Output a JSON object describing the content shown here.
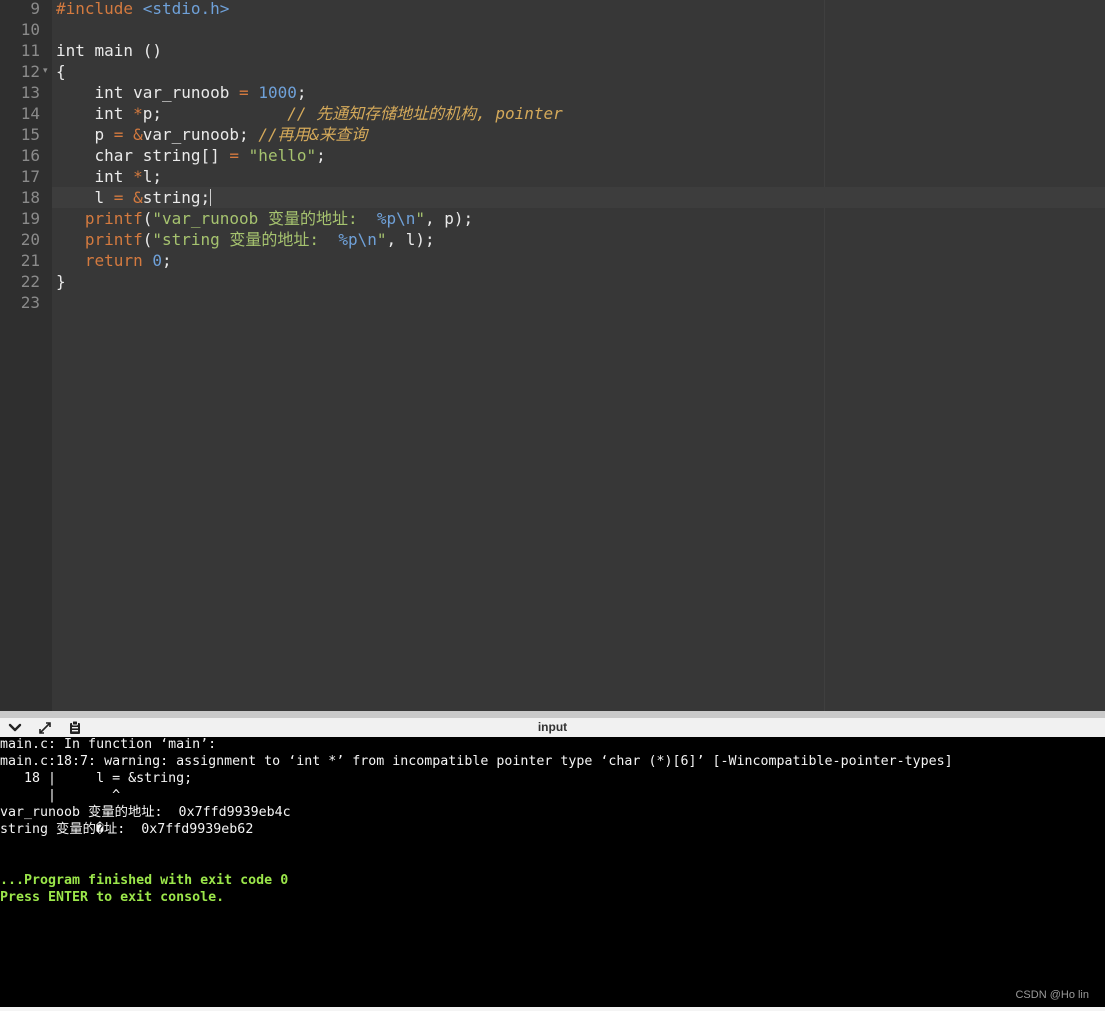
{
  "editor": {
    "line_numbers": [
      "9",
      "10",
      "11",
      "12",
      "13",
      "14",
      "15",
      "16",
      "17",
      "18",
      "19",
      "20",
      "21",
      "22",
      "23"
    ],
    "fold_marker": "▾",
    "code": {
      "l9_directive": "#include",
      "l9_header": " <stdio.h>",
      "l11": "int main ()",
      "l12": "{",
      "l13_a": "    int var_runoob ",
      "l13_op": "=",
      "l13_sp": " ",
      "l13_num": "1000",
      "l13_end": ";",
      "l14_a": "    int ",
      "l14_star": "*",
      "l14_b": "p;",
      "l14_pad": "             ",
      "l14_comment": "// 先通知存储地址的机构, pointer",
      "l15_a": "    p ",
      "l15_op": "=",
      "l15_sp": " ",
      "l15_amp": "&",
      "l15_b": "var_runoob; ",
      "l15_comment": "//再用&来查询",
      "l16_a": "    char string[] ",
      "l16_op": "=",
      "l16_sp": " ",
      "l16_str": "\"hello\"",
      "l16_end": ";",
      "l17_a": "    int ",
      "l17_star": "*",
      "l17_b": "l;",
      "l18_a": "    l ",
      "l18_op": "=",
      "l18_sp": " ",
      "l18_amp": "&",
      "l18_b": "string;",
      "l19_indent": "   ",
      "l19_fn": "printf",
      "l19_paren": "(",
      "l19_str": "\"var_runoob 变量的地址:  ",
      "l19_fmt": "%p\\n",
      "l19_q": "\"",
      "l19_end": ", p);",
      "l20_indent": "   ",
      "l20_fn": "printf",
      "l20_paren": "(",
      "l20_str": "\"string 变量的地址:  ",
      "l20_fmt": "%p\\n",
      "l20_q": "\"",
      "l20_end": ", l);",
      "l21_indent": "   ",
      "l21_kw": "return",
      "l21_sp": " ",
      "l21_num": "0",
      "l21_end": ";",
      "l22": "}"
    }
  },
  "io_panel": {
    "title": "input",
    "icons": [
      "chevron-down-icon",
      "expand-icon",
      "clipboard-icon"
    ]
  },
  "console": {
    "lines": [
      "main.c: In function ‘main’:",
      "main.c:18:7: warning: assignment to ‘int *’ from incompatible pointer type ‘char (*)[6]’ [-Wincompatible-pointer-types]",
      "   18 |     l = &string;",
      "      |       ^",
      "var_runoob 变量的地址:  0x7ffd9939eb4c",
      "string 变量的�址:  0x7ffd9939eb62"
    ],
    "finished": "...Program finished with exit code 0",
    "press_enter": "Press ENTER to exit console."
  },
  "watermark": "CSDN @Ho lin",
  "colors": {
    "editor_bg": "#373737",
    "gutter_bg": "#2f2f2f",
    "keyword_orange": "#d47a3f",
    "number_blue": "#6fa1d9",
    "string_green": "#a6c36f",
    "comment_gold": "#d4a95a",
    "console_bg": "#000000",
    "console_success": "#9be64a"
  }
}
